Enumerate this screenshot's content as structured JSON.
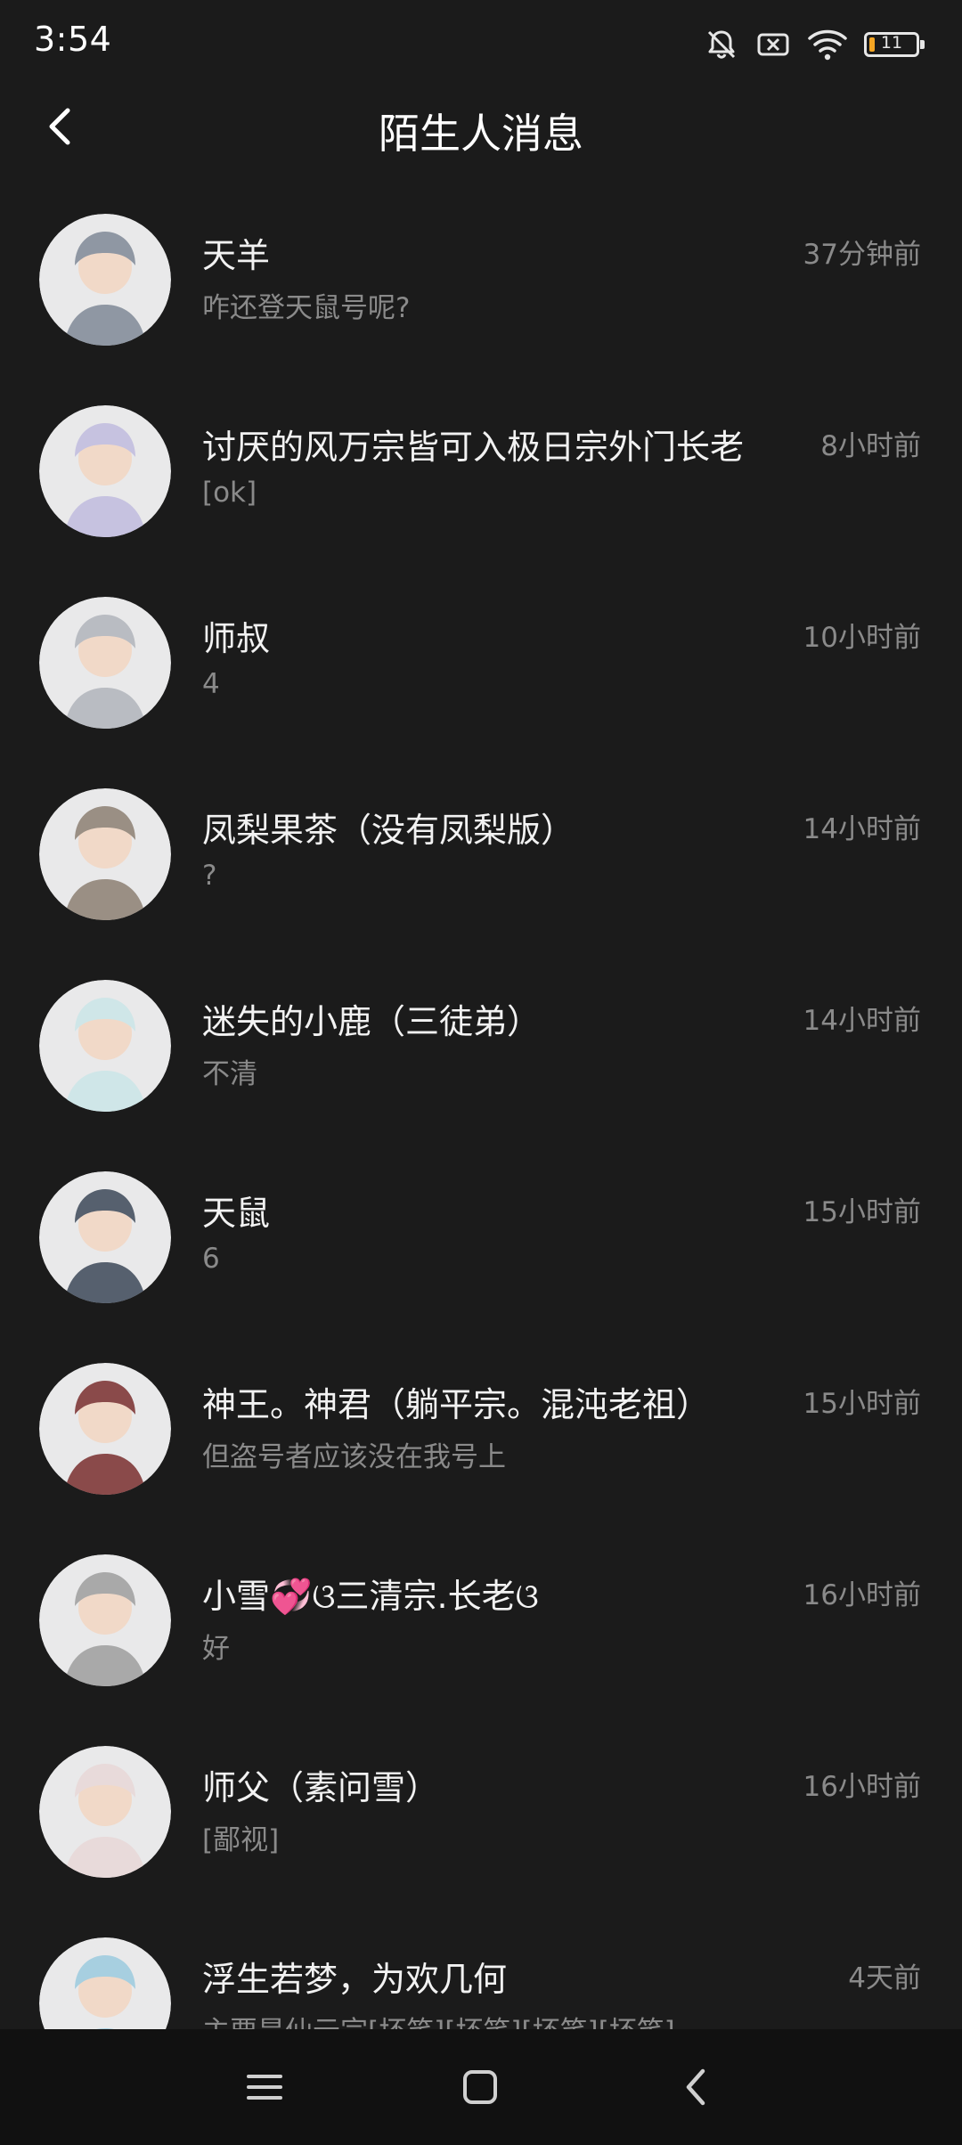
{
  "status_bar": {
    "time": "3:54",
    "battery_level": "11",
    "icons": [
      "bell-muted-icon",
      "sim-off-icon",
      "wifi-icon",
      "battery-icon"
    ]
  },
  "header": {
    "title": "陌生人消息",
    "back_icon": "chevron-left-icon"
  },
  "messages": [
    {
      "name": "天羊",
      "message": "咋还登天鼠号呢?",
      "time": "37分钟前",
      "avatar_color": "#8f97a3"
    },
    {
      "name": "讨厌的风万宗皆可入极日宗外门长老",
      "message": "[ok]",
      "time": "8小时前",
      "avatar_color": "#c6c2e0"
    },
    {
      "name": "师叔",
      "message": "4",
      "time": "10小时前",
      "avatar_color": "#b9bcc2"
    },
    {
      "name": "凤梨果茶（没有凤梨版）",
      "message": "?",
      "time": "14小时前",
      "avatar_color": "#9a8f84"
    },
    {
      "name": "迷失的小鹿（三徒弟）",
      "message": "不清",
      "time": "14小时前",
      "avatar_color": "#cfe6e8"
    },
    {
      "name": "天鼠",
      "message": "6",
      "time": "15小时前",
      "avatar_color": "#56606e"
    },
    {
      "name": "神王。神君（躺平宗。混沌老祖）",
      "message": "但盗号者应该没在我号上",
      "time": "15小时前",
      "avatar_color": "#8a4a4a"
    },
    {
      "name": "小雪💞ଓ三清宗.长老ଓ",
      "message": "好",
      "time": "16小时前",
      "avatar_color": "#a9a9a9"
    },
    {
      "name": "师父（素问雪）",
      "message": "[鄙视]",
      "time": "16小时前",
      "avatar_color": "#e8dada"
    },
    {
      "name": "浮生若梦，为欢几何",
      "message": "主要是仙云宗[坏笑][坏笑][坏笑][坏笑]",
      "time": "4天前",
      "avatar_color": "#a7cfe0"
    }
  ],
  "nav_bar": {
    "menu_icon": "menu-icon",
    "home_icon": "home-square-icon",
    "back_icon": "back-triangle-icon"
  }
}
